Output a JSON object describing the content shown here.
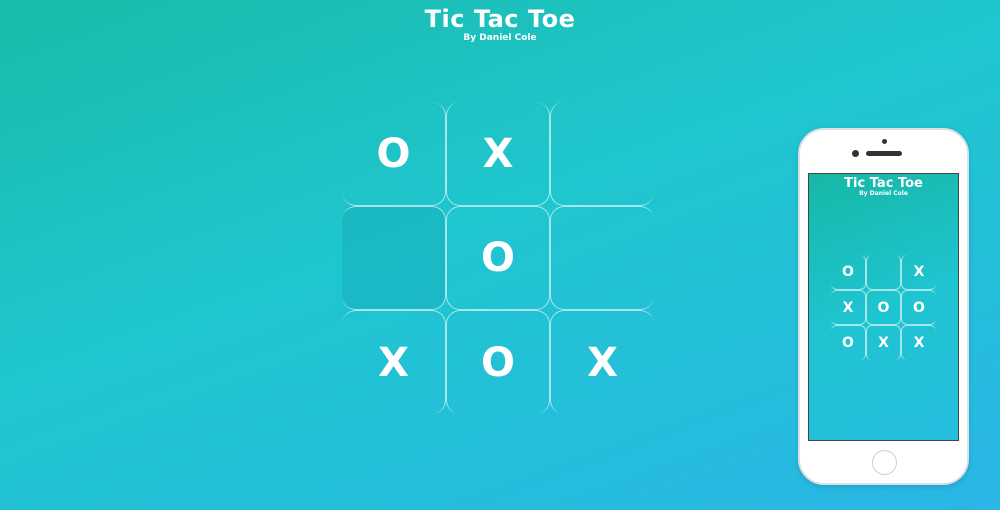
{
  "header": {
    "title": "Tic Tac Toe",
    "author": "By Daniel Cole"
  },
  "board": {
    "cells": [
      "O",
      "X",
      "",
      "",
      "O",
      "",
      "X",
      "O",
      "X"
    ],
    "highlighted_cell_index": 3
  },
  "phone": {
    "title": "Tic Tac Toe",
    "author": "By Daniel Cole",
    "cells": [
      "O",
      "",
      "X",
      "X",
      "O",
      "O",
      "O",
      "X",
      "X"
    ]
  },
  "colors": {
    "background_start": "#19bba9",
    "background_end": "#2ab6e6",
    "mark": "#ffffff",
    "phone_body": "#ffffff"
  }
}
